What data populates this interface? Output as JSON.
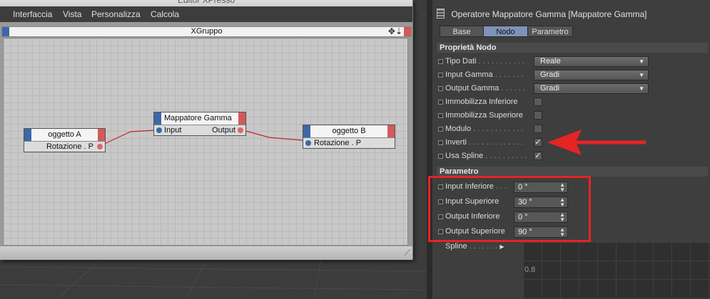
{
  "xpresso": {
    "title": "Editor XPresso",
    "menu": [
      "Interfaccia",
      "Vista",
      "Personalizza",
      "Calcola"
    ],
    "group_title": "XGruppo",
    "nodes": {
      "a": {
        "title": "oggetto A",
        "port": "Rotazione . P"
      },
      "gamma": {
        "title": "Mappatore Gamma",
        "input": "Input",
        "output": "Output"
      },
      "b": {
        "title": "oggetto B",
        "port": "Rotazione . P"
      }
    }
  },
  "attr": {
    "title": "Operatore Mappatore Gamma [Mappatore Gamma]",
    "tabs": [
      "Base",
      "Nodo",
      "Parametro"
    ],
    "active_tab": "Nodo",
    "section_node": "Proprietà Nodo",
    "node_props": [
      {
        "label": "Tipo Dati",
        "dots": " . . . . . . . . . . .",
        "kind": "dropdown",
        "value": "Reale"
      },
      {
        "label": "Input Gamma",
        "dots": " . . . . . . .",
        "kind": "dropdown",
        "value": "Gradi"
      },
      {
        "label": "Output Gamma",
        "dots": " . . . . . .",
        "kind": "dropdown",
        "value": "Gradi"
      },
      {
        "label": "Immobilizza Inferiore",
        "dots": "",
        "kind": "checkbox",
        "checked": false
      },
      {
        "label": "Immobilizza Superiore",
        "dots": "",
        "kind": "checkbox",
        "checked": false
      },
      {
        "label": "Modulo",
        "dots": " . . . . . . . . . . . .",
        "kind": "checkbox",
        "checked": false
      },
      {
        "label": "Inverti",
        "dots": " . . . . . . . . . . . . .",
        "kind": "checkbox",
        "checked": true
      },
      {
        "label": "Usa Spline",
        "dots": " . . . . . . . . . .",
        "kind": "checkbox",
        "checked": true
      }
    ],
    "section_param": "Parametro",
    "params": [
      {
        "label": "Input Inferiore",
        "dots": " . . .",
        "value": "0 °"
      },
      {
        "label": "Input Superiore",
        "dots": "",
        "value": "30 °"
      },
      {
        "label": "Output Inferiore",
        "dots": "",
        "value": "0 °"
      },
      {
        "label": "Output Superiore",
        "dots": "",
        "value": "90 °"
      }
    ],
    "spline_label": "Spline",
    "spline_dots": " . . . . . . .",
    "spline_axis_value": "0.8"
  },
  "colors": {
    "annotation_red": "#e52424",
    "tab_active": "#7f92b8",
    "port_in": "#3b68a8",
    "port_out": "#d86a6a"
  },
  "icons": {
    "calculator": "calculator-icon",
    "move": "move-icon",
    "down": "arrow-down-icon"
  }
}
